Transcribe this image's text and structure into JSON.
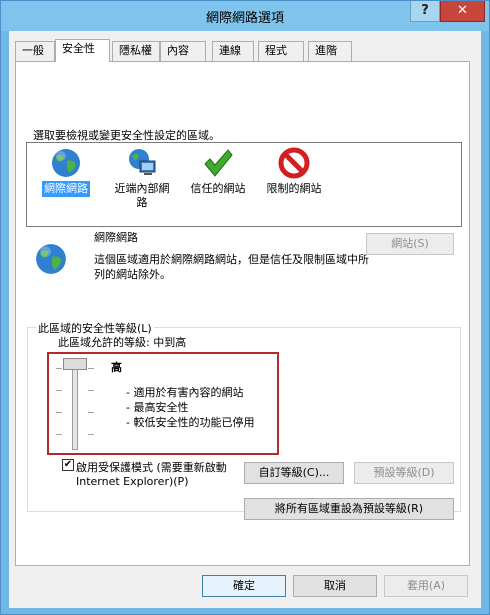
{
  "window": {
    "title": "網際網路選項",
    "help_label": "?",
    "close_label": "✕"
  },
  "tabs": [
    {
      "label": "一般"
    },
    {
      "label": "安全性"
    },
    {
      "label": "隱私權"
    },
    {
      "label": "內容"
    },
    {
      "label": "連線"
    },
    {
      "label": "程式"
    },
    {
      "label": "進階"
    }
  ],
  "zones": {
    "prompt": "選取要檢視或變更安全性設定的區域。",
    "items": [
      {
        "label": "網際網路",
        "icon": "globe-icon"
      },
      {
        "label": "近端內部網路",
        "icon": "intranet-icon"
      },
      {
        "label": "信任的網站",
        "icon": "checkmark-icon"
      },
      {
        "label": "限制的網站",
        "icon": "restricted-icon"
      }
    ]
  },
  "zone_info": {
    "name": "網際網路",
    "description": "這個區域適用於網際網路網站，但是信任及限制區域中所列的網站除外。",
    "sites_button": "網站(S)"
  },
  "security_level": {
    "group_label": "此區域的安全性等級(L)",
    "allowed": "此區域允許的等級: 中到高",
    "level": "高",
    "bullets": [
      "- 適用於有害內容的網站",
      "- 最高安全性",
      "- 較低安全性的功能已停用"
    ]
  },
  "protected_mode": {
    "checked": true,
    "line1": "啟用受保護模式 (需要重新啟動",
    "line2": "Internet Explorer)(P)"
  },
  "buttons": {
    "custom_level": "自訂等級(C)...",
    "default_level": "預設等級(D)",
    "reset_all": "將所有區域重設為預設等級(R)",
    "ok": "確定",
    "cancel": "取消",
    "apply": "套用(A)"
  },
  "colors": {
    "accent": "#3399ff",
    "highlight_border": "#b22a2a",
    "title_bar": "#7ec4ed"
  }
}
